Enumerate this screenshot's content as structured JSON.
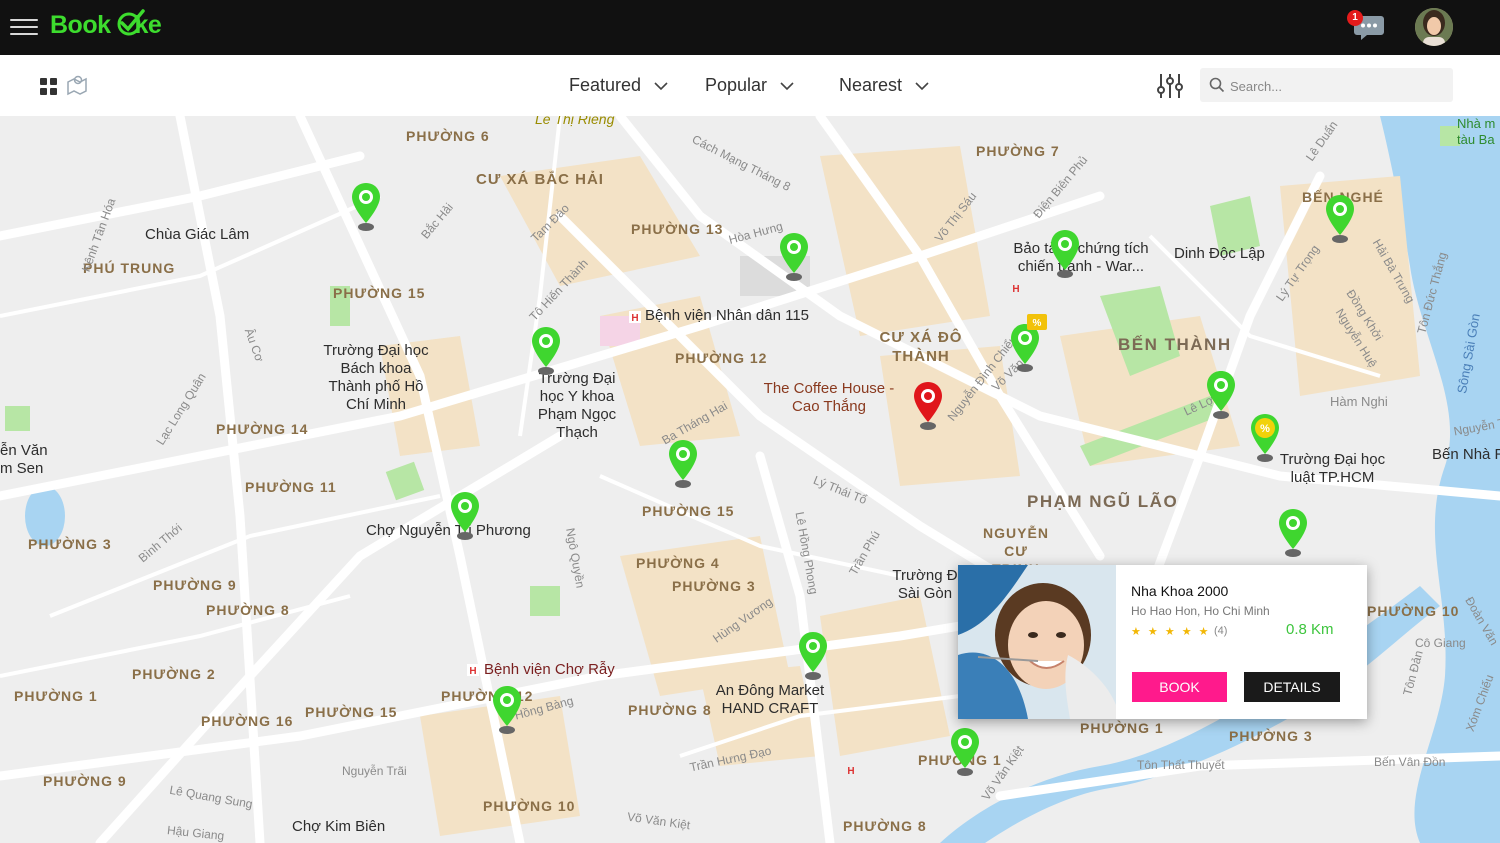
{
  "app": {
    "logo_text": "Book",
    "logo_suffix": "ke",
    "chat_badge": "1"
  },
  "filters": [
    {
      "label": "Featured"
    },
    {
      "label": "Popular"
    },
    {
      "label": "Nearest"
    }
  ],
  "search": {
    "placeholder": "Search..."
  },
  "map": {
    "districts": [
      "PHƯỜNG 6",
      "CƯ XÁ BẮC HẢI",
      "PHƯỜNG 13",
      "PHƯỜNG 7",
      "BẾN NGHÉ",
      "PHÚ TRUNG",
      "PHƯỜNG 15",
      "CƯ XÁ ĐÔ THÀNH",
      "BẾN THÀNH",
      "PHƯỜNG 12",
      "PHƯỜNG 14",
      "PHƯỜNG 11",
      "PHƯỜNG 15",
      "PHẠM NGŨ LÃO",
      "NGUYỄN CƯ TRINH",
      "PHƯỜNG 3",
      "PHƯỜNG 9",
      "PHƯỜNG 8",
      "PHƯỜNG 4",
      "PHƯỜNG 3",
      "PHƯỜNG 2",
      "PHƯỜNG 1",
      "PHƯỜNG 16",
      "PHƯỜNG 15",
      "PHƯỜNG 8",
      "PHƯỜNG 9",
      "PHƯỜNG 10",
      "PHƯỜNG 1",
      "PHƯỜNG 3",
      "PHƯỜNG 10",
      "PHƯỜNG 8",
      "PHƯỜNG 1"
    ],
    "places": {
      "chua_giac_lam": "Chùa Giác Lâm",
      "dh_bach_khoa": "Trường Đại học Bách khoa Thành phố Hồ Chí Minh",
      "dh_y_pham_ngoc_thach": "Trường Đại học Y khoa Phạm Ngọc Thạch",
      "bv_nhan_dan_115": "Bệnh viện Nhân dân 115",
      "coffee_house": "The Coffee House - Cao Thắng",
      "bao_tang": "Bảo tàng chứng tích chiến tranh - War...",
      "dinh_doc_lap": "Dinh Độc Lập",
      "cho_nguyen_tri_phuong": "Chợ Nguyễn Tri Phương",
      "dh_luat": "Trường Đại học luật TP.HCM",
      "ben_nha_rong": "Bến Nhà R",
      "bv_cho_ray": "Bệnh viện Chợ Rẫy",
      "an_dong_market": "An Đông Market HAND CRAFT",
      "cho_kim_bien": "Chợ Kim Biên",
      "truong_sai_gon": "Trường Đ Sài Gòn",
      "van_sen": "ễn Văn m Sen",
      "nha_tau": "Nhà m tàu Ba",
      "ham_nghi": "Hàm Nghi"
    },
    "roads": [
      "Lê Thị Riêng",
      "Cách Mạng Tháng 8",
      "Hòa Hưng",
      "Tam Đảo",
      "Tô Hiến Thành",
      "Bắc Hải",
      "Võ Thị Sáu",
      "Điện Biên Phủ",
      "Lê Duẩn",
      "Lý Tự Trọng",
      "Đồng Khởi",
      "Nguyễn Huệ",
      "Tôn Đức Thắng",
      "Lạc Long Quân",
      "Âu Cơ",
      "Kênh Tân Hóa",
      "Ba Tháng Hai",
      "Lý Thái Tổ",
      "Bình Thới",
      "Ngô Quyền",
      "Lê Hồng Phong",
      "Trần Phú",
      "Hùng Vương",
      "Hồng Bàng",
      "Nguyễn Trãi",
      "Lê Quang Sung",
      "Hậu Giang",
      "Trần Hưng Đạo",
      "Võ Văn Kiệt",
      "Tôn Thất Thuyết",
      "Nguyễn Đình Chiểu",
      "Võ Văn",
      "Lê Lợi",
      "Cô Giang",
      "Đoàn Văn",
      "Hải Bà Trưng",
      "Nguyễn Tất Thành",
      "Bến Vân Đồn",
      "Xóm Chiếu",
      "Tôn Đản",
      "Võ Văn Kiệt",
      "Nhà m"
    ],
    "water": "Sông Sài Gòn"
  },
  "card": {
    "title": "Nha Khoa 2000",
    "address": "Ho Hao Hon, Ho Chi Minh",
    "stars": "★ ★ ★ ★ ★",
    "review_count": "(4)",
    "distance": "0.8 Km",
    "book_label": "BOOK",
    "details_label": "DETAILS"
  },
  "colors": {
    "brand_green": "#3ddc2e",
    "pin_green": "#3fd62f",
    "pin_selected": "#e0161b",
    "book_pink": "#ff1a8c",
    "distance_green": "#3ec53e"
  }
}
